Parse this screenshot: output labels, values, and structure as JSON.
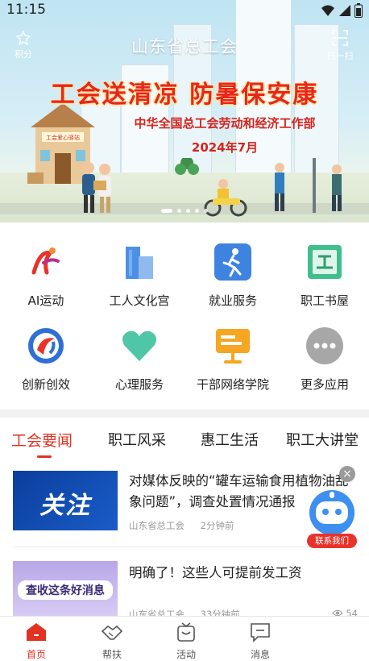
{
  "status": {
    "time": "11:15"
  },
  "header": {
    "title": "山东省总工会",
    "points_label": "积分",
    "scan_label": "扫一扫"
  },
  "banner": {
    "headline": "工会送清凉 防暑保安康",
    "subtitle": "中华全国总工会劳动和经济工作部",
    "date": "2024年7月",
    "house_sign": "工会爱心驿站",
    "slide_count": 5,
    "active_slide": 1
  },
  "services": [
    {
      "label": "AI运动",
      "icon": "ai-sport-icon"
    },
    {
      "label": "工人文化宫",
      "icon": "culture-palace-icon"
    },
    {
      "label": "就业服务",
      "icon": "employment-icon"
    },
    {
      "label": "职工书屋",
      "icon": "book-house-icon"
    },
    {
      "label": "创新创效",
      "icon": "innovation-icon"
    },
    {
      "label": "心理服务",
      "icon": "heart-icon"
    },
    {
      "label": "干部网络学院",
      "icon": "network-academy-icon"
    },
    {
      "label": "更多应用",
      "icon": "more-icon"
    }
  ],
  "tabs": [
    {
      "label": "工会要闻",
      "active": true
    },
    {
      "label": "职工风采",
      "active": false
    },
    {
      "label": "惠工生活",
      "active": false
    },
    {
      "label": "职工大讲堂",
      "active": false
    }
  ],
  "news": [
    {
      "thumb_text": "关注",
      "title": "对媒体反映的“罐车运输食用植物油乱象问题”，调查处置情况通报",
      "source": "山东省总工会",
      "time": "2分钟前"
    },
    {
      "thumb_text": "查收这条好消息",
      "title": "明确了！这些人可提前发工资",
      "source": "山东省总工会",
      "time": "33分钟前",
      "views": "54"
    }
  ],
  "floating": {
    "robot_label": "联系我们",
    "close": "×"
  },
  "bottom_nav": [
    {
      "label": "首页",
      "active": true
    },
    {
      "label": "帮扶",
      "active": false
    },
    {
      "label": "活动",
      "active": false
    },
    {
      "label": "消息",
      "active": false
    }
  ],
  "colors": {
    "accent": "#e23224",
    "headline": "#e8261b"
  }
}
